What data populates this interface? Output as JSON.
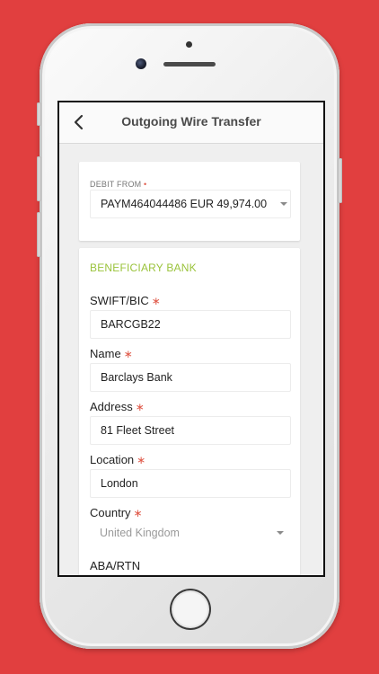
{
  "header": {
    "title": "Outgoing Wire Transfer"
  },
  "debit": {
    "label": "DEBIT FROM",
    "required_mark": "•",
    "value": "PAYM464044486 EUR 49,974.00"
  },
  "beneficiary": {
    "section_title": "BENEFICIARY BANK",
    "required_mark": "∗",
    "fields": [
      {
        "label": "SWIFT/BIC",
        "value": "BARCGB22",
        "required": true
      },
      {
        "label": "Name",
        "value": "Barclays Bank",
        "required": true
      },
      {
        "label": "Address",
        "value": "81 Fleet Street",
        "required": true
      },
      {
        "label": "Location",
        "value": "London",
        "required": true
      },
      {
        "label": "Country",
        "value": "United Kingdom",
        "required": true
      },
      {
        "label": "ABA/RTN",
        "value": "",
        "required": false
      }
    ]
  },
  "colors": {
    "background": "#e13f3f",
    "accent_green": "#9ac33b",
    "required_red": "#e05a4a"
  }
}
